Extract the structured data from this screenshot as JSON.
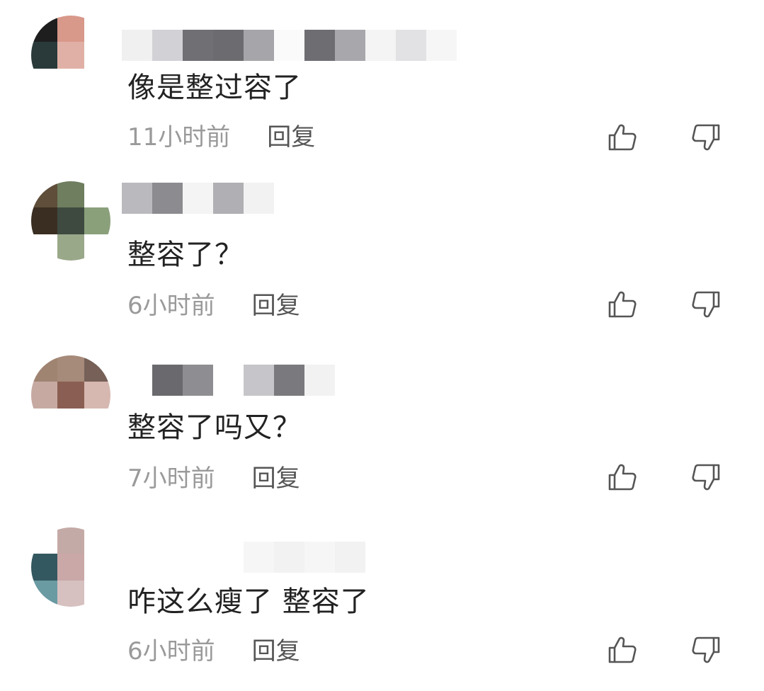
{
  "comments": [
    {
      "text": "像是整过容了",
      "time": "11小时前",
      "reply_label": "回复",
      "avatar_colors": [
        "#1e1e1e",
        "#d8988a",
        "#ffffff",
        "#2a3a3a",
        "#e0b0a6",
        "#ffffff",
        "#ffffff",
        "#ffffff",
        "#ffffff"
      ],
      "name_colors": [
        "#f0f0f0",
        "#d2d2d6",
        "#707074",
        "#6c6c70",
        "#a6a6aa",
        "#fafafa",
        "#6e6e72",
        "#a8a8ac",
        "#f4f4f4",
        "#e2e2e4",
        "#f6f6f6"
      ]
    },
    {
      "text": "整容了？",
      "time": "6小时前",
      "reply_label": "回复",
      "avatar_colors": [
        "#5e4e3a",
        "#6e7e5e",
        "#ffffff",
        "#3a2e22",
        "#3e4a40",
        "#8aa07a",
        "#ffffff",
        "#9aa88a",
        "#ffffff"
      ],
      "name_colors": [
        "#bababe",
        "#8c8c90",
        "#f4f4f4",
        "#b0b0b4",
        "#f2f2f2"
      ]
    },
    {
      "text": "整容了吗又？",
      "time": "7小时前",
      "reply_label": "回复",
      "avatar_colors": [
        "#a08472",
        "#a68a7a",
        "#766058",
        "#c6aaa2",
        "#8a5e52",
        "#d6b8b0",
        "#ffffff",
        "#ffffff",
        "#ffffff"
      ],
      "name_colors": [
        "#ffffff",
        "#6a6a6e",
        "#8e8e92",
        "#ffffff",
        "#c6c6ca",
        "#7a7a7e",
        "#f2f2f2"
      ]
    },
    {
      "text": "咋这么瘦了 整容了",
      "time": "6小时前",
      "reply_label": "回复",
      "avatar_colors": [
        "#ffffff",
        "#c4aaa6",
        "#ffffff",
        "#345860",
        "#caa8a8",
        "#ffffff",
        "#6a9aa2",
        "#d6c0c0",
        "#ffffff"
      ],
      "name_colors": [
        "#ffffff",
        "#ffffff",
        "#ffffff",
        "#ffffff",
        "#f6f6f6",
        "#f2f2f2",
        "#f6f6f6",
        "#f2f2f2"
      ]
    }
  ],
  "icons": {
    "like": "thumbs-up-icon",
    "dislike": "thumbs-down-icon"
  },
  "colors": {
    "text": "#222222",
    "meta": "#9a9a9a",
    "reply": "#555555",
    "icon": "#555555"
  }
}
